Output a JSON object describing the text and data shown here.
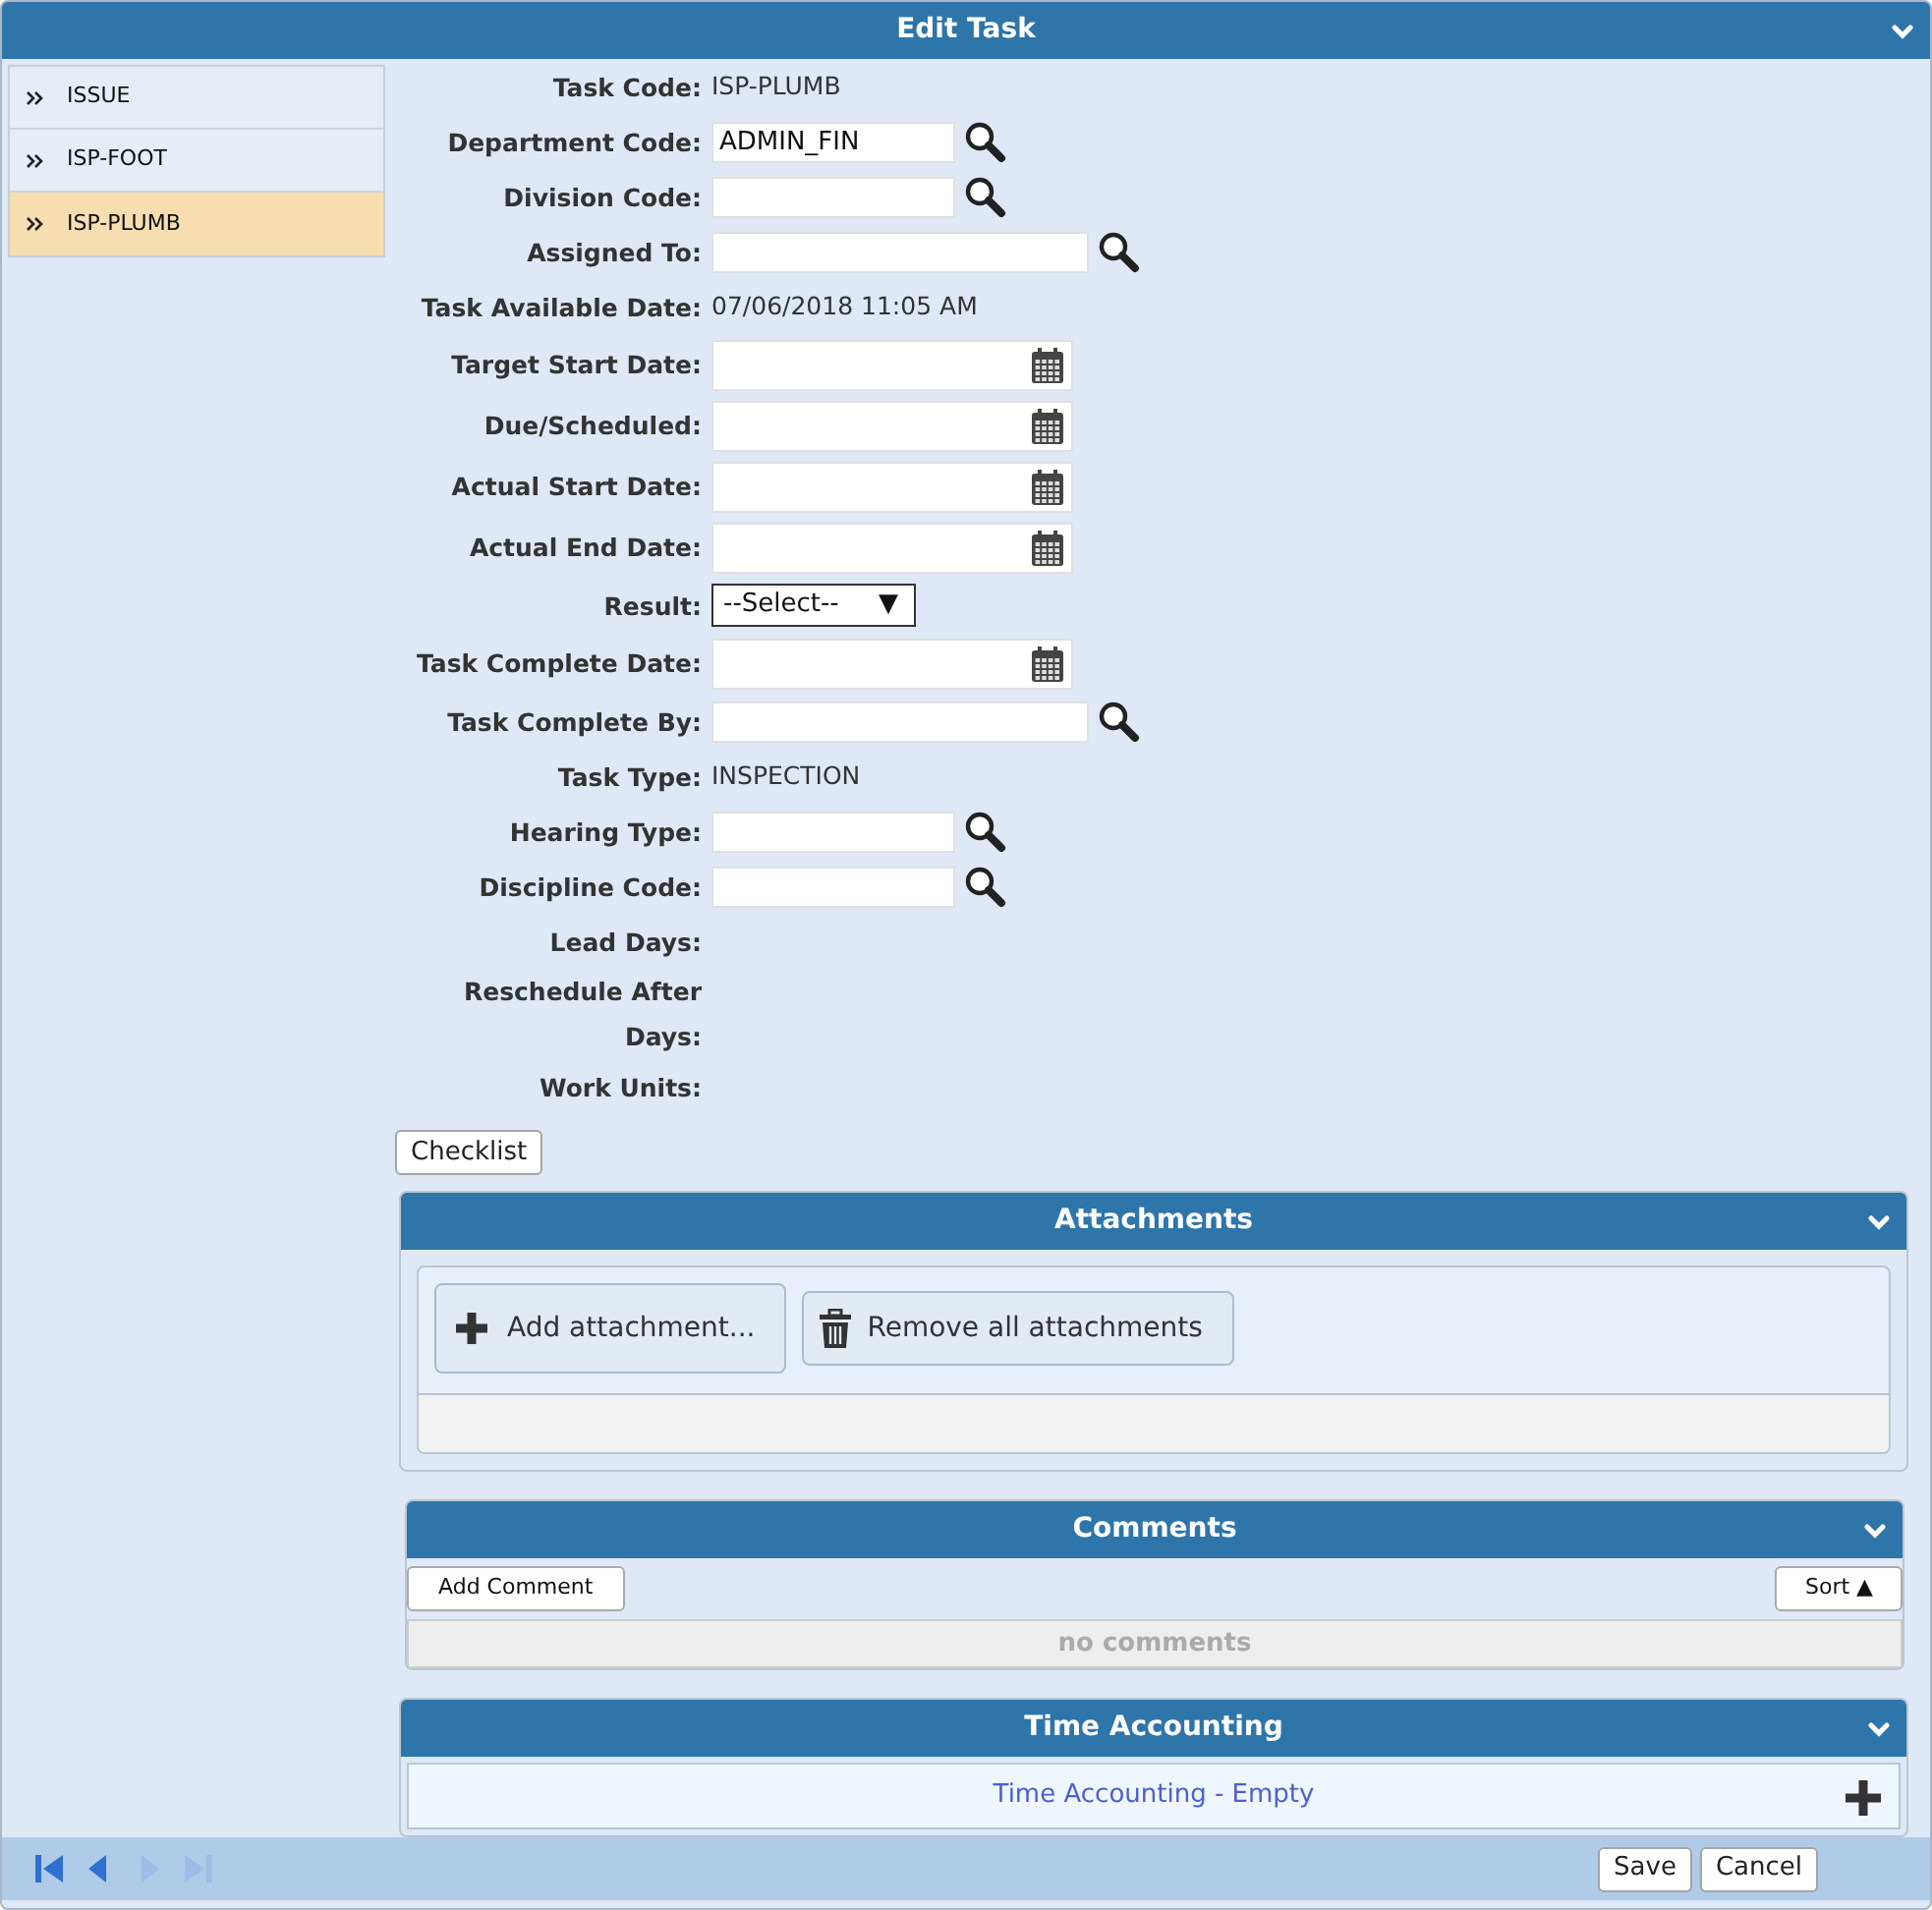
{
  "title": "Edit Task",
  "sidebar": [
    {
      "label": "ISSUE",
      "selected": false
    },
    {
      "label": "ISP-FOOT",
      "selected": false
    },
    {
      "label": "ISP-PLUMB",
      "selected": true
    }
  ],
  "fields": [
    {
      "label": "Task Code:",
      "kind": "text",
      "value": "ISP-PLUMB"
    },
    {
      "label": "Department Code:",
      "kind": "lookup",
      "value": "ADMIN_FIN"
    },
    {
      "label": "Division Code:",
      "kind": "lookup"
    },
    {
      "label": "Assigned To:",
      "kind": "user-lookup"
    },
    {
      "label": "Task Available Date:",
      "kind": "text",
      "value": "07/06/2018 11:05 AM"
    },
    {
      "label": "Target Start Date:",
      "kind": "date"
    },
    {
      "label": "Due/Scheduled:",
      "kind": "date"
    },
    {
      "label": "Actual Start Date:",
      "kind": "date"
    },
    {
      "label": "Actual End Date:",
      "kind": "date"
    },
    {
      "label": "Result:",
      "kind": "select",
      "value": "--Select--",
      "arrow": "▼"
    },
    {
      "label": "Task Complete Date:",
      "kind": "date"
    },
    {
      "label": "Task Complete By:",
      "kind": "user-lookup"
    },
    {
      "label": "Task Type:",
      "kind": "text",
      "value": "INSPECTION"
    },
    {
      "label": "Hearing Type:",
      "kind": "lookup"
    },
    {
      "label": "Discipline Code:",
      "kind": "lookup"
    },
    {
      "label": "Lead Days:",
      "kind": "empty"
    },
    {
      "label": "Reschedule After Days:",
      "kind": "empty"
    },
    {
      "label": "Work Units:",
      "kind": "empty"
    }
  ],
  "checklist_button": "Checklist",
  "attachments": {
    "title": "Attachments",
    "add_button": "Add attachment...",
    "remove_button": "Remove all attachments"
  },
  "comments": {
    "title": "Comments",
    "add_button": "Add Comment",
    "sort_button": "Sort ▲",
    "empty_text": "no comments"
  },
  "time_accounting": {
    "title": "Time Accounting",
    "empty_text": "Time Accounting - Empty"
  },
  "pager": [
    {
      "kind": "first",
      "disabled": false
    },
    {
      "kind": "prev",
      "disabled": false
    },
    {
      "kind": "next",
      "disabled": true
    },
    {
      "kind": "last",
      "disabled": true
    }
  ],
  "footer_buttons": [
    "Save",
    "Cancel"
  ]
}
